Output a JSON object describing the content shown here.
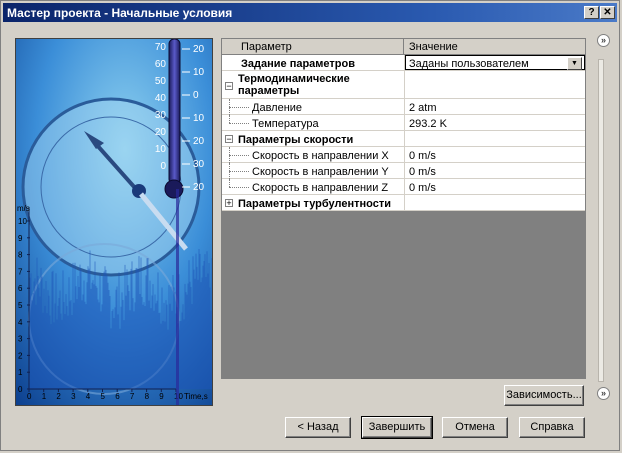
{
  "window": {
    "title": "Мастер проекта - Начальные условия"
  },
  "titlebar_buttons": {
    "help": "?",
    "close": "✕"
  },
  "chart_data": {
    "type": "area",
    "ylabel": "m/s",
    "xlabel": "Time,s",
    "x_ticks": [
      "0",
      "1",
      "2",
      "3",
      "4",
      "5",
      "6",
      "7",
      "8",
      "9",
      "10"
    ],
    "y_ticks": [
      "10",
      "9",
      "8",
      "7",
      "6",
      "5",
      "4",
      "3",
      "2",
      "1",
      "0"
    ],
    "xlim": [
      0,
      10
    ],
    "ylim": [
      0,
      10
    ]
  },
  "thermometer": {
    "left_scale": [
      "70",
      "60",
      "50",
      "40",
      "30",
      "20",
      "10",
      "0"
    ],
    "right_scale": [
      "20",
      "10",
      "0",
      "10",
      "20",
      "30",
      "20"
    ]
  },
  "grid": {
    "header": {
      "param": "Параметр",
      "value": "Значение"
    },
    "rows": [
      {
        "label": "Задание параметров",
        "value": "Заданы пользователем"
      },
      {
        "label": "Термодинамические параметры",
        "value": ""
      },
      {
        "label": "Давление",
        "value": "2 atm"
      },
      {
        "label": "Температура",
        "value": "293.2 K"
      },
      {
        "label": "Параметры скорости",
        "value": ""
      },
      {
        "label": "Скорость в направлении X",
        "value": "0 m/s"
      },
      {
        "label": "Скорость в направлении Y",
        "value": "0 m/s"
      },
      {
        "label": "Скорость в направлении Z",
        "value": "0 m/s"
      },
      {
        "label": "Параметры турбулентности",
        "value": ""
      }
    ],
    "expander_minus": "−",
    "expander_plus": "+",
    "dropdown_arrow": "▼"
  },
  "buttons": {
    "dependency": "Зависимость...",
    "back": "< Назад",
    "finish": "Завершить",
    "cancel": "Отмена",
    "help": "Справка"
  },
  "side_buttons": {
    "top": "»",
    "bottom": "»"
  }
}
